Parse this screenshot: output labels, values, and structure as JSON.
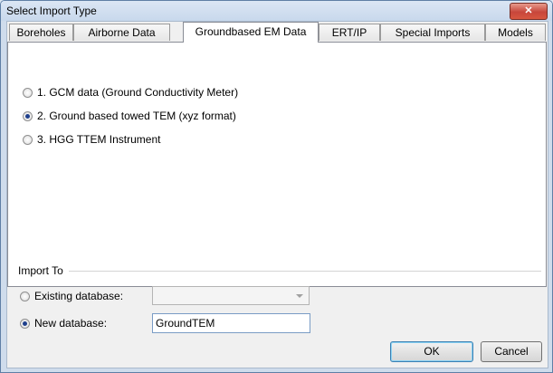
{
  "window": {
    "title": "Select Import Type",
    "close_glyph": "✕"
  },
  "tabs": [
    {
      "label": "Boreholes"
    },
    {
      "label": "Airborne Data"
    },
    {
      "label": "Groundbased EM Data"
    },
    {
      "label": "ERT/IP"
    },
    {
      "label": "Special Imports"
    },
    {
      "label": "Models"
    }
  ],
  "active_tab": "Groundbased EM Data",
  "options": [
    {
      "label": "1. GCM data (Ground Conductivity Meter)",
      "checked": false
    },
    {
      "label": "2. Ground based towed TEM (xyz format)",
      "checked": true
    },
    {
      "label": "3. HGG TTEM Instrument",
      "checked": false
    }
  ],
  "import_to": {
    "title": "Import To",
    "existing": {
      "label": "Existing database:",
      "checked": false,
      "value": ""
    },
    "new": {
      "label": "New database:",
      "checked": true,
      "value": "GroundTEM"
    }
  },
  "buttons": {
    "ok": "OK",
    "cancel": "Cancel"
  },
  "colors": {
    "close_button": "#c7463b",
    "radio_dot": "#1f3f8c",
    "panel_bg": "#ffffff"
  }
}
